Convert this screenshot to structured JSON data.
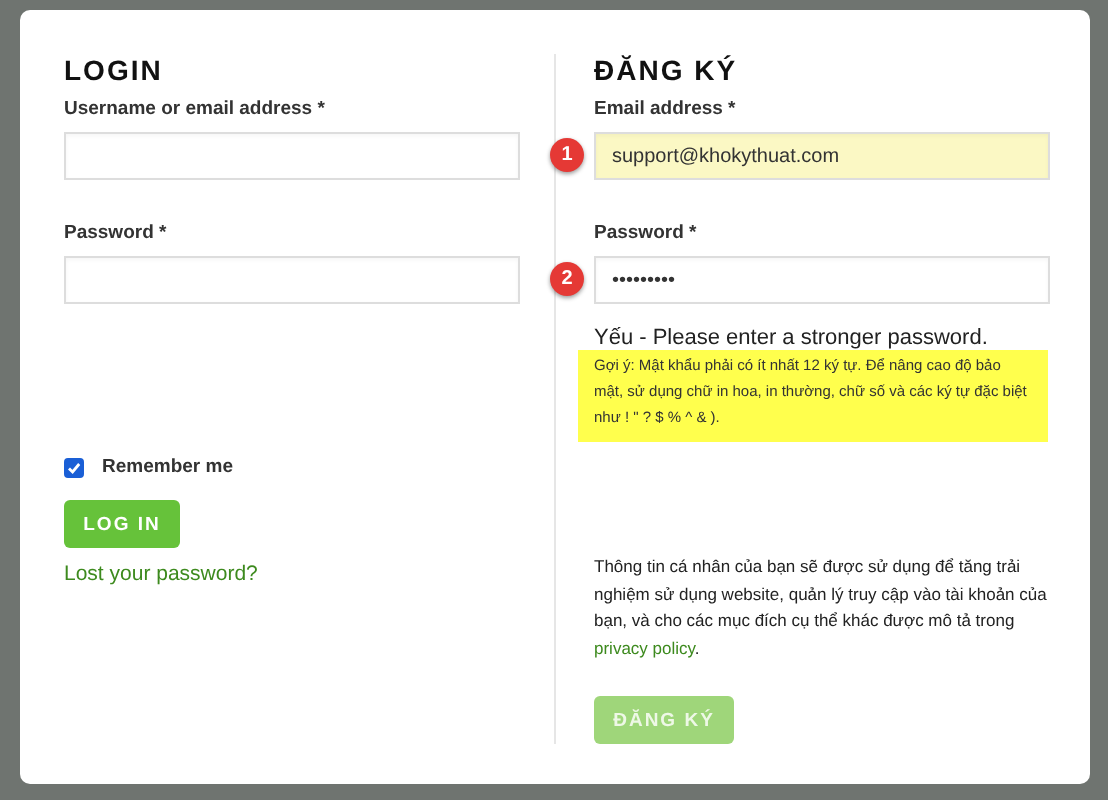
{
  "login": {
    "title": "LOGIN",
    "username_label": "Username or email address *",
    "password_label": "Password *",
    "remember": {
      "label": "Remember me",
      "checked": true
    },
    "button": "LOG IN",
    "lost_password": "Lost your password?"
  },
  "register": {
    "title": "ĐĂNG KÝ",
    "email_label": "Email address *",
    "email_value": "support@khokythuat.com",
    "email_badge": "1",
    "password_label": "Password *",
    "password_value": "•••••••••",
    "password_badge": "2",
    "strength": "Yếu - Please enter a stronger password.",
    "hint": "Gợi ý: Mật khẩu phải có ít nhất 12 ký tự. Để nâng cao độ bảo mật, sử dụng chữ in hoa, in thường, chữ số và các ký tự đặc biệt như ! \" ? $ % ^ & ).",
    "privacy_text": "Thông tin cá nhân của bạn sẽ được sử dụng để tăng trải nghiệm sử dụng website, quản lý truy cập vào tài khoản của bạn, và cho các mục đích cụ thể khác được mô tả trong",
    "privacy_link": "privacy policy",
    "privacy_end": ".",
    "button": {
      "label": "ĐĂNG KÝ",
      "disabled": true
    }
  }
}
